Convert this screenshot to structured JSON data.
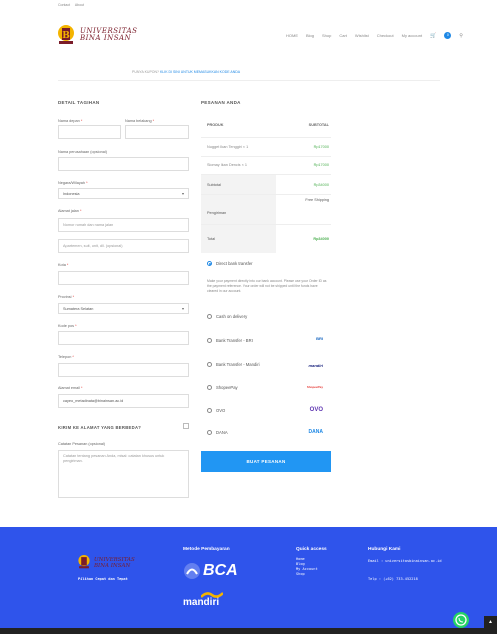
{
  "topbar": {
    "links": [
      "Contact",
      "About"
    ]
  },
  "header": {
    "brand_line1": "UNIVERSITAS",
    "brand_line2": "BINA INSAN",
    "nav": [
      "HOME",
      "Blog",
      "Shop",
      "Cart",
      "Wishlist",
      "Checkout",
      "My account"
    ],
    "cart_count": "0"
  },
  "notice": {
    "prefix": "PUNYA KUPON?",
    "link": "KLIK DI SINI UNTUK MEMASUKKAN KODE ANDA"
  },
  "billing": {
    "title": "DETAIL TAGIHAN",
    "first_name_label": "Nama depan",
    "last_name_label": "Nama belakang",
    "company_label": "Nama perusahaan (opsional)",
    "country_label": "Negara/Wilayah",
    "country_value": "Indonesia",
    "street_label": "Alamat jalan",
    "street_placeholder": "Nomor rumah dan nama jalan",
    "street2_placeholder": "Apartemen, suit, unit, dll. (opsional)",
    "city_label": "Kota",
    "province_label": "Provinsi",
    "province_value": "Sumatera Selatan",
    "postcode_label": "Kode pos",
    "phone_label": "Telepon",
    "email_label": "Alamat email",
    "email_value": "cayeo_metadinata@binainsan.ac.id",
    "ship_diff_label": "KIRIM KE ALAMAT YANG BERBEDA?",
    "notes_label": "Catatan Pesanan (opsional)",
    "notes_placeholder": "Catatan tentang pesanan Anda, misal: catatan khusus untuk pengiriman."
  },
  "order": {
    "title": "PESANAN ANDA",
    "col_product": "PRODUK",
    "col_subtotal": "SUBTOTAL",
    "items": [
      {
        "name": "Nugget Ikan Tenggiri × 1",
        "price": "Rp17000"
      },
      {
        "name": "Siomay Ikan Dencis × 1",
        "price": "Rp17000"
      }
    ],
    "subtotal_label": "Subtotal",
    "subtotal_value": "Rp34000",
    "shipping_label": "Pengiriman",
    "shipping_value": "Free Shipping",
    "total_label": "Total",
    "total_value": "Rp34000"
  },
  "payment": {
    "options": [
      {
        "label": "Direct bank transfer",
        "selected": true
      },
      {
        "label": "Cash on delivery"
      },
      {
        "label": "Bank Transfer - BRI",
        "logo": "BRI"
      },
      {
        "label": "Bank Transfer - Mandiri",
        "logo": "mandiri"
      },
      {
        "label": "ShopeePay",
        "logo": "ShopeePay"
      },
      {
        "label": "OVO",
        "logo": "OVO"
      },
      {
        "label": "DANA",
        "logo": "DANA"
      }
    ],
    "bank_description": "Make your payment directly into our bank account. Please use your Order ID as the payment reference. Your order will not be shipped until the funds have cleared in our account.",
    "place_order": "BUAT PESANAN"
  },
  "footer": {
    "brand_line1": "UNIVERSITAS",
    "brand_line2": "BINA INSAN",
    "tagline": "Pilihan Cepat dan Tepat",
    "payment_title": "Metode Pembayaran",
    "bank1": "BCA",
    "bank2": "mandiri",
    "quick_title": "Quick access",
    "quick_links": [
      "Home",
      "Blog",
      "My Account",
      "Shop"
    ],
    "contact_title": "Hubungi Kami",
    "email": "Email : universitasbinainsan.ac.id",
    "phone": "Telp : (+62) 733-452218"
  },
  "colors": {
    "accent": "#2196f3",
    "footer": "#2f54eb",
    "brand": "#7a1d2a"
  }
}
